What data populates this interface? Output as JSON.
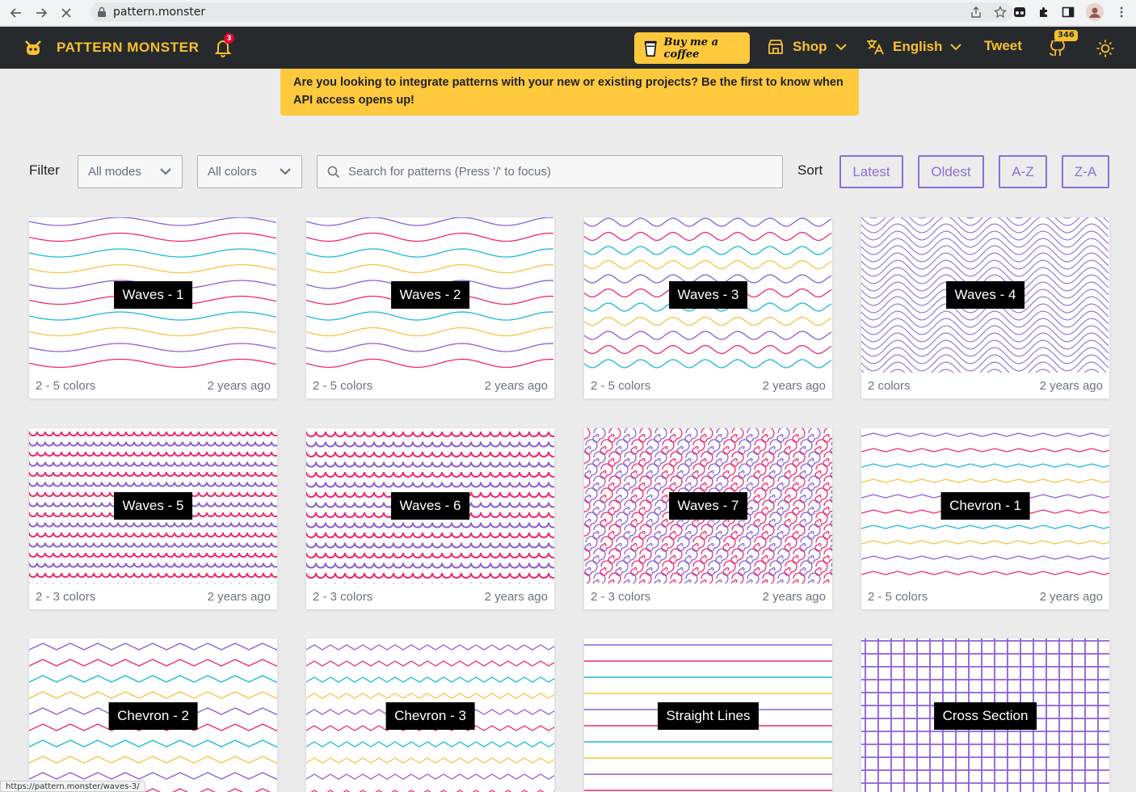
{
  "browser": {
    "url": "pattern.monster",
    "status_url": "https://pattern.monster/waves-3/"
  },
  "header": {
    "logo": "PATTERN MONSTER",
    "notification_count": "3",
    "coffee_label": "Buy me a coffee",
    "shop_label": "Shop",
    "language_label": "English",
    "tweet_label": "Tweet",
    "github_stars": "346"
  },
  "banner": {
    "text": "Are you looking to integrate patterns with your new or existing projects? Be the first to know when API access opens up!"
  },
  "filters": {
    "label": "Filter",
    "modes_value": "All modes",
    "colors_value": "All colors",
    "search_placeholder": "Search for patterns (Press '/' to focus)"
  },
  "sort": {
    "label": "Sort",
    "options": [
      "Latest",
      "Oldest",
      "A-Z",
      "Z-A"
    ]
  },
  "patterns": [
    {
      "name": "Waves - 1",
      "colors": "2 - 5 colors",
      "age": "2 years ago"
    },
    {
      "name": "Waves - 2",
      "colors": "2 - 5 colors",
      "age": "2 years ago"
    },
    {
      "name": "Waves - 3",
      "colors": "2 - 5 colors",
      "age": "2 years ago"
    },
    {
      "name": "Waves - 4",
      "colors": "2 colors",
      "age": "2 years ago"
    },
    {
      "name": "Waves - 5",
      "colors": "2 - 3 colors",
      "age": "2 years ago"
    },
    {
      "name": "Waves - 6",
      "colors": "2 - 3 colors",
      "age": "2 years ago"
    },
    {
      "name": "Waves - 7",
      "colors": "2 - 3 colors",
      "age": "2 years ago"
    },
    {
      "name": "Chevron - 1",
      "colors": "2 - 5 colors",
      "age": "2 years ago"
    },
    {
      "name": "Chevron - 2",
      "colors": "",
      "age": ""
    },
    {
      "name": "Chevron - 3",
      "colors": "",
      "age": ""
    },
    {
      "name": "Straight Lines",
      "colors": "",
      "age": ""
    },
    {
      "name": "Cross Section",
      "colors": "",
      "age": ""
    }
  ],
  "theme": {
    "accent": "#f9c02e",
    "header_bg": "#272a2d",
    "sort_color": "#8b6fd6",
    "pattern_colors": [
      "#8b5fd6",
      "#f0286e",
      "#1ab8d8",
      "#f4c542"
    ]
  }
}
